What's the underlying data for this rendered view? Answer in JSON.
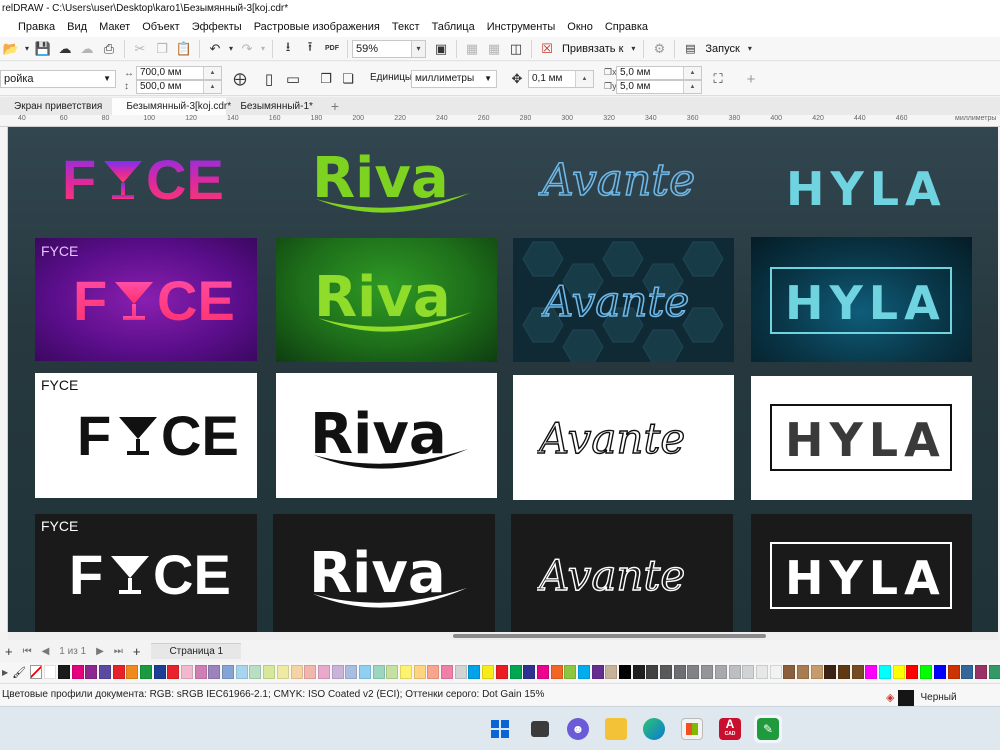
{
  "window": {
    "title": "relDRAW - C:\\Users\\user\\Desktop\\karo1\\Безымянный-3[koj.cdr*"
  },
  "menu": {
    "items": [
      "Правка",
      "Вид",
      "Макет",
      "Объект",
      "Эффекты",
      "Растровые изображения",
      "Текст",
      "Таблица",
      "Инструменты",
      "Окно",
      "Справка"
    ]
  },
  "toolbar": {
    "zoom_value": "59%",
    "snap_label": "Привязать к",
    "launch_label": "Запуск",
    "pdf_label": "PDF"
  },
  "propbar": {
    "preset_value": "ройка",
    "width_value": "700,0 мм",
    "height_value": "500,0 мм",
    "units_label": "Единицы:",
    "units_value": "миллиметры",
    "nudge_value": "0,1 мм",
    "dup_x_value": "5,0 мм",
    "dup_y_value": "5,0 мм"
  },
  "tabs": [
    {
      "label": "Экран приветствия"
    },
    {
      "label": "Безымянный-3[koj.cdr*"
    },
    {
      "label": "Безымянный-1*"
    }
  ],
  "ruler": {
    "labels": [
      "40",
      "60",
      "80",
      "100",
      "120",
      "140",
      "160",
      "180",
      "200",
      "220",
      "240",
      "260",
      "280",
      "300",
      "320",
      "340",
      "360",
      "380",
      "400",
      "420",
      "440",
      "460"
    ],
    "unit": "миллиметры"
  },
  "canvas": {
    "logos": {
      "fyce": "FYCE",
      "fyce_left": "F",
      "fyce_right": "CE",
      "riva": "Riva",
      "avante": "Avante",
      "hyla": "HYLA"
    }
  },
  "pagenav": {
    "page_of": "1 из 1",
    "page_tab": "Страница 1"
  },
  "palette": {
    "colors": [
      "#ffffff",
      "#1a1a1a",
      "#e5007e",
      "#8e278f",
      "#5a4ba0",
      "#e6212b",
      "#f08a1d",
      "#199c3f",
      "#1d3f94",
      "#e8212a",
      "#f3b8cf",
      "#d07fb5",
      "#9b83bd",
      "#85a3d4",
      "#a7d5ee",
      "#b9dfc3",
      "#d8e89a",
      "#eeeaa3",
      "#f6d3a5",
      "#f2b6ae",
      "#e9a8cc",
      "#c9b3d8",
      "#a9bde2",
      "#8fd0f2",
      "#9bd6c2",
      "#c5e0a0",
      "#fff26f",
      "#ffd37f",
      "#f9a48d",
      "#f180a8",
      "#d1d3d4",
      "#00a2e8",
      "#f7ec1a",
      "#ed1c24",
      "#00a650",
      "#2e3192",
      "#ec008c",
      "#f26522",
      "#8dc63f",
      "#00aeef",
      "#662d91",
      "#c7b299",
      "#000000",
      "#231f20",
      "#414042",
      "#58595b",
      "#6d6e71",
      "#808285",
      "#939598",
      "#a7a9ac",
      "#bcbec0",
      "#d1d3d4",
      "#e6e7e8",
      "#f1f2f2",
      "#8b5e3c",
      "#a97c50",
      "#c69c6d",
      "#3c2415",
      "#603913",
      "#754c24",
      "#ff00ff",
      "#00ffff",
      "#ffff00",
      "#ff0000",
      "#00ff00",
      "#0000ff",
      "#cc3300",
      "#336699",
      "#993366",
      "#339966",
      "#666699",
      "#996633",
      "#cccc00"
    ]
  },
  "status": {
    "profiles": "Цветовые профили документа: RGB: sRGB IEC61966-2.1; CMYK: ISO Coated v2 (ECI); Оттенки серого: Dot Gain 15%",
    "fill_label": "Черный"
  },
  "taskbar": {
    "cad_label": "CAD"
  }
}
